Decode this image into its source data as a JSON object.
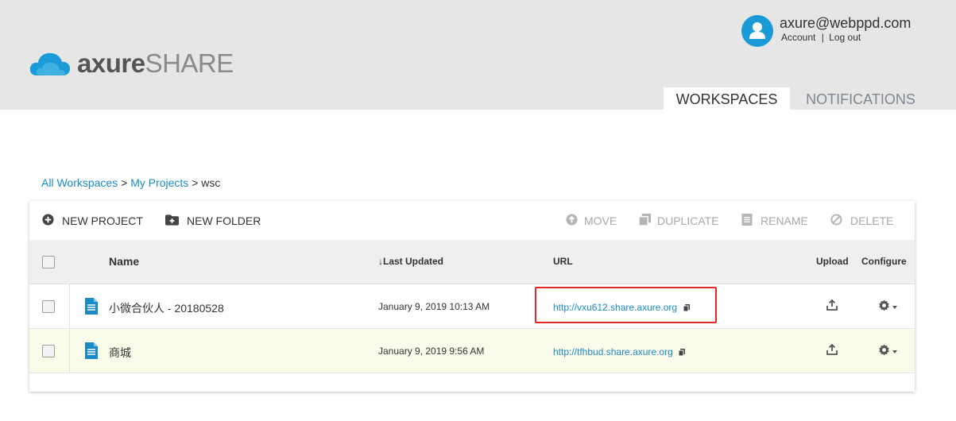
{
  "brand": {
    "part1": "axure",
    "part2": "SHARE"
  },
  "user": {
    "email": "axure@webppd.com",
    "account_link": "Account",
    "separator": "|",
    "logout_link": "Log out"
  },
  "tabs": [
    {
      "label": "WORKSPACES",
      "active": true
    },
    {
      "label": "NOTIFICATIONS",
      "active": false
    }
  ],
  "breadcrumb": {
    "all": "All Workspaces",
    "sep1": ">",
    "projects": "My Projects",
    "sep2": ">",
    "current": "wsc"
  },
  "toolbar": {
    "new_project": "NEW PROJECT",
    "new_folder": "NEW FOLDER",
    "move": "MOVE",
    "duplicate": "DUPLICATE",
    "rename": "RENAME",
    "delete": "DELETE"
  },
  "table": {
    "columns": {
      "name": "Name",
      "last_updated": "Last Updated",
      "url": "URL",
      "upload": "Upload",
      "configure": "Configure"
    },
    "sort_indicator": "↓",
    "rows": [
      {
        "name": "小微合伙人 - 20180528",
        "updated": "January 9, 2019 10:13 AM",
        "url": "http://vxu612.share.axure.org",
        "highlighted": true
      },
      {
        "name": "商城",
        "updated": "January 9, 2019 9:56 AM",
        "url": "http://tfhbud.share.axure.org",
        "highlighted": false
      }
    ]
  },
  "colors": {
    "accent": "#1a9ad6",
    "link": "#1a8ac6",
    "header_bg": "#e6e6e6",
    "highlight_box": "#e32727",
    "selected_row": "#fbfbe9"
  },
  "icons": [
    "cloud-logo-icon",
    "user-avatar-icon",
    "plus-circle-icon",
    "folder-plus-icon",
    "move-icon",
    "duplicate-icon",
    "rename-icon",
    "delete-icon",
    "file-icon",
    "copy-icon",
    "upload-icon",
    "gear-icon",
    "caret-down-icon"
  ]
}
